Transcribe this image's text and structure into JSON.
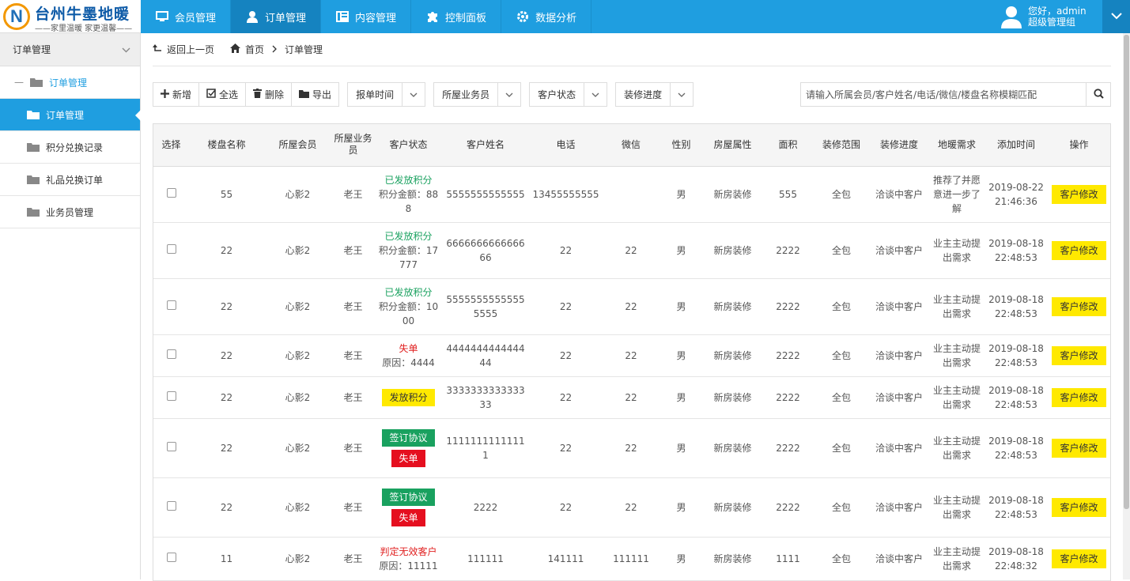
{
  "brand": {
    "name": "台州牛墨地暖",
    "slogan": "——家里温暖 家更温馨——",
    "mark": "N"
  },
  "nav": [
    {
      "label": "会员管理",
      "icon": "monitor-icon",
      "active": false
    },
    {
      "label": "订单管理",
      "icon": "user-icon",
      "active": true
    },
    {
      "label": "内容管理",
      "icon": "content-icon",
      "active": false
    },
    {
      "label": "控制面板",
      "icon": "puzzle-icon",
      "active": false
    },
    {
      "label": "数据分析",
      "icon": "gear-icon",
      "active": false
    }
  ],
  "user": {
    "greeting": "您好，admin",
    "role": "超级管理组"
  },
  "sidebar": {
    "header": "订单管理",
    "parent": {
      "label": "订单管理",
      "prefix": "—"
    },
    "items": [
      {
        "label": "订单管理",
        "active": true
      },
      {
        "label": "积分兑换记录",
        "active": false
      },
      {
        "label": "礼品兑换订单",
        "active": false
      },
      {
        "label": "业务员管理",
        "active": false
      }
    ]
  },
  "breadcrumb": {
    "back": "返回上一页",
    "home": "首页",
    "current": "订单管理"
  },
  "toolbar": {
    "add": "新增",
    "select_all": "全选",
    "delete": "删除",
    "export": "导出",
    "filters": [
      "报单时间",
      "所屋业务员",
      "客户状态",
      "装修进度"
    ]
  },
  "search": {
    "placeholder": "请输入所属会员/客户姓名/电话/微信/楼盘名称模糊匹配",
    "value": ""
  },
  "table": {
    "headers": [
      "选择",
      "楼盘名称",
      "所屋会员",
      "所屋业务员",
      "客户状态",
      "客户姓名",
      "电话",
      "微信",
      "性别",
      "房屋属性",
      "面积",
      "装修范围",
      "装修进度",
      "地暖需求",
      "添加时间",
      "操作"
    ],
    "edit_label": "客户修改",
    "rows": [
      {
        "building": "55",
        "member": "心影2",
        "agent": "老王",
        "status_text": "已发放积分",
        "status_sub": "积分金额：888",
        "name": "5555555555555",
        "phone": "13455555555",
        "wechat": "",
        "gender": "男",
        "house": "新房装修",
        "area": "555",
        "scope": "全包",
        "progress": "洽谈中客户",
        "demand": "推荐了并愿意进一步了解",
        "date": "2019-08-22",
        "time": "21:46:36"
      },
      {
        "building": "22",
        "member": "心影2",
        "agent": "老王",
        "status_text": "已发放积分",
        "status_sub": "积分金额：17777",
        "name": "666666666666666",
        "phone": "22",
        "wechat": "22",
        "gender": "男",
        "house": "新房装修",
        "area": "2222",
        "scope": "全包",
        "progress": "洽谈中客户",
        "demand": "业主主动提出需求",
        "date": "2019-08-18",
        "time": "22:48:53"
      },
      {
        "building": "22",
        "member": "心影2",
        "agent": "老王",
        "status_text": "已发放积分",
        "status_sub": "积分金额：1000",
        "name": "55555555555555555",
        "phone": "22",
        "wechat": "22",
        "gender": "男",
        "house": "新房装修",
        "area": "2222",
        "scope": "全包",
        "progress": "洽谈中客户",
        "demand": "业主主动提出需求",
        "date": "2019-08-18",
        "time": "22:48:53"
      },
      {
        "building": "22",
        "member": "心影2",
        "agent": "老王",
        "status_text": "失单",
        "status_sub": "原因：4444",
        "name": "444444444444444",
        "phone": "22",
        "wechat": "22",
        "gender": "男",
        "house": "新房装修",
        "area": "2222",
        "scope": "全包",
        "progress": "洽谈中客户",
        "demand": "业主主动提出需求",
        "date": "2019-08-18",
        "time": "22:48:53"
      },
      {
        "building": "22",
        "member": "心影2",
        "agent": "老王",
        "status_btn": "发放积分",
        "name": "333333333333333",
        "phone": "22",
        "wechat": "22",
        "gender": "男",
        "house": "新房装修",
        "area": "2222",
        "scope": "全包",
        "progress": "洽谈中客户",
        "demand": "业主主动提出需求",
        "date": "2019-08-18",
        "time": "22:48:53"
      },
      {
        "building": "22",
        "member": "心影2",
        "agent": "老王",
        "status_btn_green": "签订协议",
        "status_btn_red": "失单",
        "name": "11111111111111",
        "phone": "22",
        "wechat": "22",
        "gender": "男",
        "house": "新房装修",
        "area": "2222",
        "scope": "全包",
        "progress": "洽谈中客户",
        "demand": "业主主动提出需求",
        "date": "2019-08-18",
        "time": "22:48:53"
      },
      {
        "building": "22",
        "member": "心影2",
        "agent": "老王",
        "status_btn_green": "签订协议",
        "status_btn_red": "失单",
        "name": "2222",
        "phone": "22",
        "wechat": "22",
        "gender": "男",
        "house": "新房装修",
        "area": "2222",
        "scope": "全包",
        "progress": "洽谈中客户",
        "demand": "业主主动提出需求",
        "date": "2019-08-18",
        "time": "22:48:53"
      },
      {
        "building": "11",
        "member": "心影2",
        "agent": "老王",
        "status_text": "判定无效客户",
        "status_sub": "原因：11111",
        "name": "111111",
        "phone": "141111",
        "wechat": "111111",
        "gender": "男",
        "house": "新房装修",
        "area": "1111",
        "scope": "全包",
        "progress": "洽谈中客户",
        "demand": "业主主动提出需求",
        "date": "2019-08-18",
        "time": "22:48:32"
      }
    ]
  },
  "colors": {
    "primary": "#1f9ee0",
    "nav_active": "#1583c0",
    "yellow": "#ffe900",
    "green": "#19a15f",
    "red": "#e50f1f"
  }
}
